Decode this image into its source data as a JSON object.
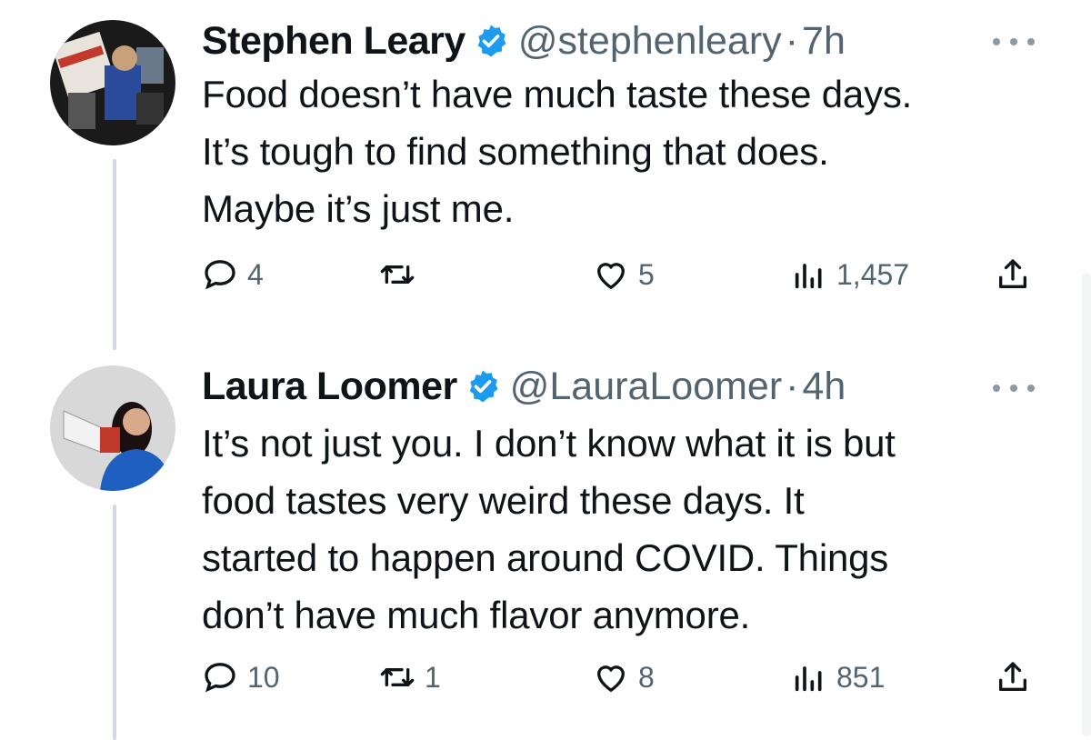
{
  "tweets": [
    {
      "name": "Stephen Leary",
      "handle": "@stephenleary",
      "separator": "·",
      "time": "7h",
      "text_lines": [
        "Food doesn’t have much taste these days.",
        "It’s tough to find something that does.",
        "Maybe it’s just me."
      ],
      "stats": {
        "replies": "4",
        "retweets": "",
        "likes": "5",
        "views": "1,457"
      }
    },
    {
      "name": "Laura Loomer",
      "handle": "@LauraLoomer",
      "separator": "·",
      "time": "4h",
      "text_lines": [
        "It’s not just you. I don’t know what it is but",
        "food tastes very weird these days. It",
        "started to happen around COVID. Things",
        "don’t have much flavor anymore."
      ],
      "stats": {
        "replies": "10",
        "retweets": "1",
        "likes": "8",
        "views": "851"
      }
    }
  ],
  "colors": {
    "text": "#0f1419",
    "secondary": "#536471",
    "verified": "#1d9bf0",
    "thread_line": "#cfd9de"
  },
  "icons": [
    "reply-icon",
    "retweet-icon",
    "like-icon",
    "views-icon",
    "share-icon",
    "verified-badge-icon",
    "more-icon"
  ]
}
